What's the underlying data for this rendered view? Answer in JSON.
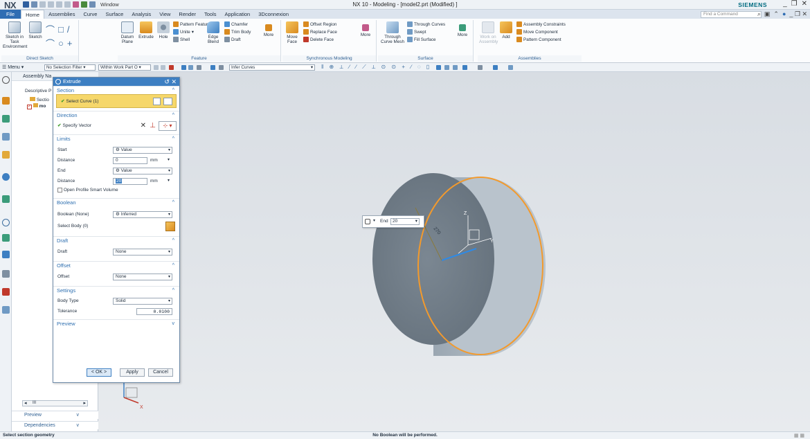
{
  "app": {
    "logo": "NX",
    "window_menu": "Window",
    "title": "NX 10 - Modeling - [model2.prt (Modified) ]",
    "brand": "SIEMENS"
  },
  "tabs": [
    "File",
    "Home",
    "Assemblies",
    "Curve",
    "Surface",
    "Analysis",
    "View",
    "Render",
    "Tools",
    "Application",
    "3Dconnexion"
  ],
  "command_finder": {
    "placeholder": "Find a Command"
  },
  "ribbon": {
    "direct_sketch": {
      "label": "Direct Sketch",
      "sketch_env": "Sketch in Task Environment",
      "sketch": "Sketch"
    },
    "feature": {
      "label": "Feature",
      "datum_plane": "Datum Plane",
      "extrude": "Extrude",
      "hole": "Hole",
      "pattern_feature": "Pattern Feature",
      "unite": "Unite",
      "shell": "Shell",
      "edge_blend": "Edge Blend",
      "chamfer": "Chamfer",
      "trim_body": "Trim Body",
      "draft": "Draft",
      "more": "More"
    },
    "synchronous": {
      "label": "Synchronous Modeling",
      "move_face": "Move Face",
      "offset_region": "Offset Region",
      "replace_face": "Replace Face",
      "delete_face": "Delete Face",
      "more": "More"
    },
    "surface": {
      "label": "Surface",
      "through_curve_mesh": "Through Curve Mesh",
      "through_curves": "Through Curves",
      "swept": "Swept",
      "fill_surface": "Fill Surface",
      "more": "More"
    },
    "assemblies": {
      "label": "Assemblies",
      "work_on_assembly": "Work on Assembly",
      "add": "Add",
      "assembly_constraints": "Assembly Constraints",
      "move_component": "Move Component",
      "pattern_component": "Pattern Component"
    }
  },
  "selbar": {
    "menu": "Menu",
    "selection_filter": "No Selection Filter",
    "scope": "Within Work Part O",
    "curve_rule": "Infer Curves"
  },
  "navigator": {
    "title": "Assembly Na",
    "column": "Descriptive P",
    "rows": [
      "Sectio",
      "mo"
    ],
    "scroll_label": "III",
    "preview": "Preview",
    "dependencies": "Dependencies"
  },
  "dialog": {
    "title": "Extrude",
    "section": {
      "label": "Section",
      "select_curve": "Select Curve (1)"
    },
    "direction": {
      "label": "Direction",
      "specify_vector": "Specify Vector"
    },
    "limits": {
      "label": "Limits",
      "start_label": "Start",
      "start_value": "Value",
      "distance1_label": "Distance",
      "distance1_value": "0",
      "distance1_unit": "mm",
      "end_label": "End",
      "end_value": "Value",
      "distance2_label": "Distance",
      "distance2_value": "20",
      "distance2_unit": "mm",
      "open_profile": "Open Profile Smart Volume"
    },
    "boolean": {
      "label": "Boolean",
      "boolean_label": "Boolean (None)",
      "boolean_value": "Inferred",
      "select_body": "Select Body (0)"
    },
    "draft": {
      "label": "Draft",
      "draft_label": "Draft",
      "draft_value": "None"
    },
    "offset": {
      "label": "Offset",
      "offset_label": "Offset",
      "offset_value": "None"
    },
    "settings": {
      "label": "Settings",
      "body_type_label": "Body Type",
      "body_type_value": "Solid",
      "tolerance_label": "Tolerance",
      "tolerance_value": "0.0100"
    },
    "preview": {
      "label": "Preview"
    },
    "buttons": {
      "ok": "< OK >",
      "apply": "Apply",
      "cancel": "Cancel"
    }
  },
  "onscreen_input": {
    "end_label": "End",
    "end_value": "20",
    "angle_label": "270"
  },
  "triad": {
    "x": "X",
    "y": "Y",
    "z": "Z"
  },
  "status": {
    "left": "Select section geometry",
    "center": "No Boolean will be performed."
  },
  "colors": {
    "accent": "#2f6db3",
    "highlight": "#f6d76a",
    "edge_highlight": "#f39a2c",
    "part_body": "#7e8a95"
  }
}
